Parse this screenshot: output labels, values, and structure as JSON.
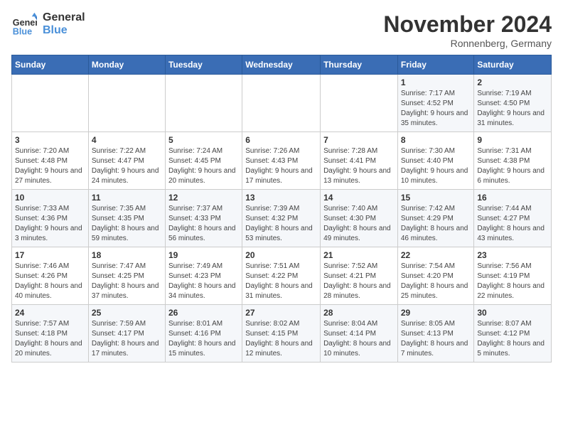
{
  "logo": {
    "line1": "General",
    "line2": "Blue"
  },
  "header": {
    "month": "November 2024",
    "location": "Ronnenberg, Germany"
  },
  "weekdays": [
    "Sunday",
    "Monday",
    "Tuesday",
    "Wednesday",
    "Thursday",
    "Friday",
    "Saturday"
  ],
  "weeks": [
    [
      {
        "day": "",
        "info": ""
      },
      {
        "day": "",
        "info": ""
      },
      {
        "day": "",
        "info": ""
      },
      {
        "day": "",
        "info": ""
      },
      {
        "day": "",
        "info": ""
      },
      {
        "day": "1",
        "info": "Sunrise: 7:17 AM\nSunset: 4:52 PM\nDaylight: 9 hours and 35 minutes."
      },
      {
        "day": "2",
        "info": "Sunrise: 7:19 AM\nSunset: 4:50 PM\nDaylight: 9 hours and 31 minutes."
      }
    ],
    [
      {
        "day": "3",
        "info": "Sunrise: 7:20 AM\nSunset: 4:48 PM\nDaylight: 9 hours and 27 minutes."
      },
      {
        "day": "4",
        "info": "Sunrise: 7:22 AM\nSunset: 4:47 PM\nDaylight: 9 hours and 24 minutes."
      },
      {
        "day": "5",
        "info": "Sunrise: 7:24 AM\nSunset: 4:45 PM\nDaylight: 9 hours and 20 minutes."
      },
      {
        "day": "6",
        "info": "Sunrise: 7:26 AM\nSunset: 4:43 PM\nDaylight: 9 hours and 17 minutes."
      },
      {
        "day": "7",
        "info": "Sunrise: 7:28 AM\nSunset: 4:41 PM\nDaylight: 9 hours and 13 minutes."
      },
      {
        "day": "8",
        "info": "Sunrise: 7:30 AM\nSunset: 4:40 PM\nDaylight: 9 hours and 10 minutes."
      },
      {
        "day": "9",
        "info": "Sunrise: 7:31 AM\nSunset: 4:38 PM\nDaylight: 9 hours and 6 minutes."
      }
    ],
    [
      {
        "day": "10",
        "info": "Sunrise: 7:33 AM\nSunset: 4:36 PM\nDaylight: 9 hours and 3 minutes."
      },
      {
        "day": "11",
        "info": "Sunrise: 7:35 AM\nSunset: 4:35 PM\nDaylight: 8 hours and 59 minutes."
      },
      {
        "day": "12",
        "info": "Sunrise: 7:37 AM\nSunset: 4:33 PM\nDaylight: 8 hours and 56 minutes."
      },
      {
        "day": "13",
        "info": "Sunrise: 7:39 AM\nSunset: 4:32 PM\nDaylight: 8 hours and 53 minutes."
      },
      {
        "day": "14",
        "info": "Sunrise: 7:40 AM\nSunset: 4:30 PM\nDaylight: 8 hours and 49 minutes."
      },
      {
        "day": "15",
        "info": "Sunrise: 7:42 AM\nSunset: 4:29 PM\nDaylight: 8 hours and 46 minutes."
      },
      {
        "day": "16",
        "info": "Sunrise: 7:44 AM\nSunset: 4:27 PM\nDaylight: 8 hours and 43 minutes."
      }
    ],
    [
      {
        "day": "17",
        "info": "Sunrise: 7:46 AM\nSunset: 4:26 PM\nDaylight: 8 hours and 40 minutes."
      },
      {
        "day": "18",
        "info": "Sunrise: 7:47 AM\nSunset: 4:25 PM\nDaylight: 8 hours and 37 minutes."
      },
      {
        "day": "19",
        "info": "Sunrise: 7:49 AM\nSunset: 4:23 PM\nDaylight: 8 hours and 34 minutes."
      },
      {
        "day": "20",
        "info": "Sunrise: 7:51 AM\nSunset: 4:22 PM\nDaylight: 8 hours and 31 minutes."
      },
      {
        "day": "21",
        "info": "Sunrise: 7:52 AM\nSunset: 4:21 PM\nDaylight: 8 hours and 28 minutes."
      },
      {
        "day": "22",
        "info": "Sunrise: 7:54 AM\nSunset: 4:20 PM\nDaylight: 8 hours and 25 minutes."
      },
      {
        "day": "23",
        "info": "Sunrise: 7:56 AM\nSunset: 4:19 PM\nDaylight: 8 hours and 22 minutes."
      }
    ],
    [
      {
        "day": "24",
        "info": "Sunrise: 7:57 AM\nSunset: 4:18 PM\nDaylight: 8 hours and 20 minutes."
      },
      {
        "day": "25",
        "info": "Sunrise: 7:59 AM\nSunset: 4:17 PM\nDaylight: 8 hours and 17 minutes."
      },
      {
        "day": "26",
        "info": "Sunrise: 8:01 AM\nSunset: 4:16 PM\nDaylight: 8 hours and 15 minutes."
      },
      {
        "day": "27",
        "info": "Sunrise: 8:02 AM\nSunset: 4:15 PM\nDaylight: 8 hours and 12 minutes."
      },
      {
        "day": "28",
        "info": "Sunrise: 8:04 AM\nSunset: 4:14 PM\nDaylight: 8 hours and 10 minutes."
      },
      {
        "day": "29",
        "info": "Sunrise: 8:05 AM\nSunset: 4:13 PM\nDaylight: 8 hours and 7 minutes."
      },
      {
        "day": "30",
        "info": "Sunrise: 8:07 AM\nSunset: 4:12 PM\nDaylight: 8 hours and 5 minutes."
      }
    ]
  ]
}
